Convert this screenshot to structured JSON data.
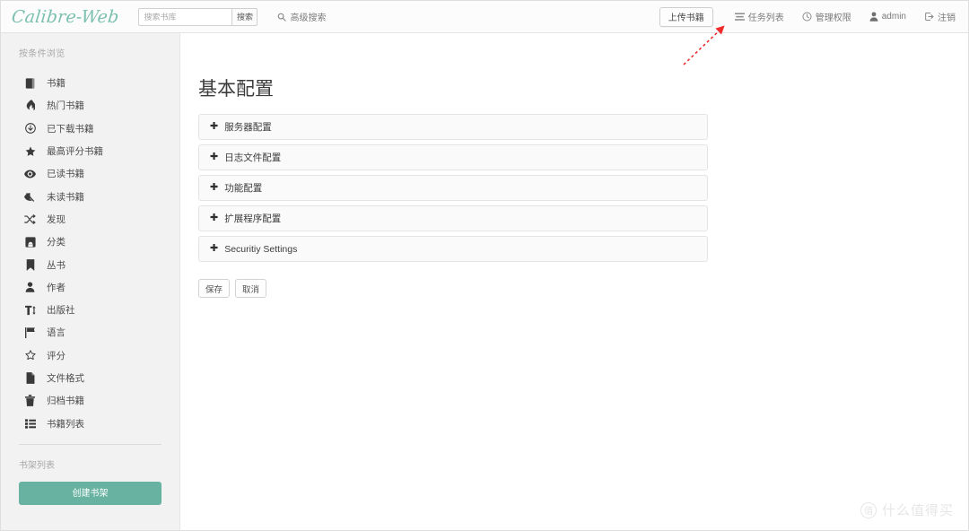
{
  "navbar": {
    "brand": "Calibre-Web",
    "search": {
      "placeholder": "搜索书库",
      "value": "",
      "button_label": "搜索",
      "icon": "search-icon"
    },
    "advanced_search": {
      "label": "高级搜索",
      "icon": "search-icon"
    },
    "upload_button": "上传书籍",
    "links": [
      {
        "label": "任务列表",
        "icon": "tasks-icon"
      },
      {
        "label": "管理权限",
        "icon": "clock-icon"
      },
      {
        "label": "admin",
        "icon": "user-icon"
      },
      {
        "label": "注销",
        "icon": "sign-out-icon"
      }
    ]
  },
  "sidebar": {
    "browse_heading": "按条件浏览",
    "items": [
      {
        "label": "书籍",
        "icon": "book-icon"
      },
      {
        "label": "热门书籍",
        "icon": "fire-icon"
      },
      {
        "label": "已下载书籍",
        "icon": "download-icon"
      },
      {
        "label": "最高评分书籍",
        "icon": "star-icon"
      },
      {
        "label": "已读书籍",
        "icon": "eye-icon"
      },
      {
        "label": "未读书籍",
        "icon": "eye-slash-icon"
      },
      {
        "label": "发现",
        "icon": "random-icon"
      },
      {
        "label": "分类",
        "icon": "inbox-icon"
      },
      {
        "label": "丛书",
        "icon": "bookmark-icon"
      },
      {
        "label": "作者",
        "icon": "user-icon"
      },
      {
        "label": "出版社",
        "icon": "text-height-icon"
      },
      {
        "label": "语言",
        "icon": "flag-icon"
      },
      {
        "label": "评分",
        "icon": "star-outline-icon"
      },
      {
        "label": "文件格式",
        "icon": "file-icon"
      },
      {
        "label": "归档书籍",
        "icon": "trash-icon"
      },
      {
        "label": "书籍列表",
        "icon": "list-icon"
      }
    ],
    "shelf_heading": "书架列表",
    "create_shelf_label": "创建书架"
  },
  "main": {
    "title": "基本配置",
    "panels": [
      {
        "label": "服务器配置",
        "icon": "plus-icon",
        "expanded": false
      },
      {
        "label": "日志文件配置",
        "icon": "plus-icon",
        "expanded": false
      },
      {
        "label": "功能配置",
        "icon": "plus-icon",
        "expanded": false
      },
      {
        "label": "扩展程序配置",
        "icon": "plus-icon",
        "expanded": false
      },
      {
        "label": "Securitiy Settings",
        "icon": "plus-icon",
        "expanded": false
      }
    ],
    "save_label": "保存",
    "cancel_label": "取消"
  },
  "annotation": {
    "type": "arrow",
    "color": "#ef2b2b",
    "points_to": "上传书籍"
  },
  "watermark": {
    "badge": "值",
    "text": "什么值得买"
  },
  "colors": {
    "brand_teal": "#7cc0b0",
    "shelf_button": "#67b2a0",
    "sidebar_bg": "#f2f2f2",
    "panel_bg": "#fafafa",
    "annotation_red": "#ef2b2b"
  }
}
